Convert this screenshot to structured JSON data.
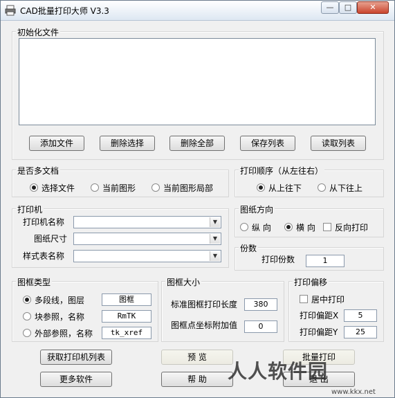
{
  "window": {
    "title": "CAD批量打印大师 V3.3",
    "min": "—",
    "max": "□",
    "close": "✕"
  },
  "init_files": {
    "legend": "初始化文件",
    "buttons": {
      "add": "添加文件",
      "remove_sel": "删除选择",
      "remove_all": "删除全部",
      "save": "保存列表",
      "load": "读取列表"
    }
  },
  "multi_doc": {
    "legend": "是否多文档",
    "options": [
      "选择文件",
      "当前图形",
      "当前图形局部"
    ],
    "selected": 0
  },
  "print_order": {
    "legend": "打印顺序（从左往右）",
    "options": [
      "从上往下",
      "从下往上"
    ],
    "selected": 0
  },
  "printer": {
    "legend": "打印机",
    "labels": {
      "name": "打印机名称",
      "size": "图纸尺寸",
      "style": "样式表名称"
    },
    "values": {
      "name": "",
      "size": "",
      "style": ""
    }
  },
  "orientation": {
    "legend": "图纸方向",
    "options": [
      "纵 向",
      "横 向"
    ],
    "selected": 1,
    "reverse_label": "反向打印"
  },
  "copies": {
    "legend": "份数",
    "label": "打印份数",
    "value": "1"
  },
  "frame_type": {
    "legend": "图框类型",
    "rows": [
      {
        "label": "多段线，图层",
        "value": "图框"
      },
      {
        "label": "块参照，名称",
        "value": "RmTK"
      },
      {
        "label": "外部参照，名称",
        "value": "tk_xref"
      }
    ],
    "selected": 0
  },
  "frame_size": {
    "legend": "图框大小",
    "length_label": "标准图框打印长度",
    "length_value": "380",
    "offset_label": "图框点坐标附加值",
    "offset_value": "0"
  },
  "print_offset": {
    "legend": "打印偏移",
    "center_label": "居中打印",
    "x_label": "打印偏距X",
    "x_value": "5",
    "y_label": "打印偏距Y",
    "y_value": "25"
  },
  "actions": {
    "get_printers": "获取打印机列表",
    "preview": "预 览",
    "batch_print": "批量打印",
    "more_software": "更多软件",
    "help": "帮 助",
    "exit": "退 出"
  },
  "watermark": {
    "text": "人人软件园",
    "url": "www.kkx.net"
  }
}
